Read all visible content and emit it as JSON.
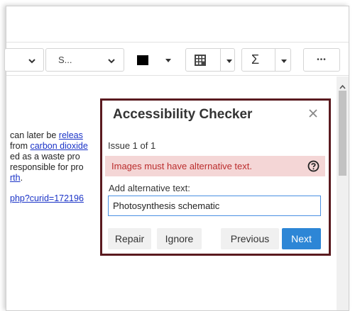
{
  "toolbar": {
    "style_select_value": "S...",
    "icons": {
      "chevron": "chevron-down-icon",
      "color": "text-color-icon",
      "table": "table-icon",
      "formula": "sigma-icon",
      "more": "more-icon"
    },
    "sigma_glyph": "Σ",
    "more_glyph": "•••"
  },
  "document": {
    "lines": [
      {
        "prefix": "can later be ",
        "link": "releas",
        "suffix": ""
      },
      {
        "prefix": "from ",
        "link": "carbon dioxide",
        "suffix": ""
      },
      {
        "prefix": "ed as a waste pro",
        "link": "",
        "suffix": ""
      },
      {
        "prefix": "responsible for pro",
        "link": "",
        "suffix": ""
      },
      {
        "prefix": "",
        "link": "rth",
        "suffix": "."
      },
      {
        "prefix": "",
        "link": "php?curid=172196",
        "suffix": ""
      }
    ]
  },
  "dialog": {
    "title": "Accessibility Checker",
    "issue_counter": "Issue 1 of 1",
    "error_message": "Images must have alternative text.",
    "alt_label": "Add alternative text:",
    "alt_value": "Photosynthesis schematic",
    "buttons": {
      "repair": "Repair",
      "ignore": "Ignore",
      "previous": "Previous",
      "next": "Next"
    }
  },
  "colors": {
    "dialog_border": "#5a1a1f",
    "error_bg": "#f4d6d6",
    "error_text": "#bb2d2d",
    "primary": "#2d86d6",
    "link": "#1a33c7"
  }
}
